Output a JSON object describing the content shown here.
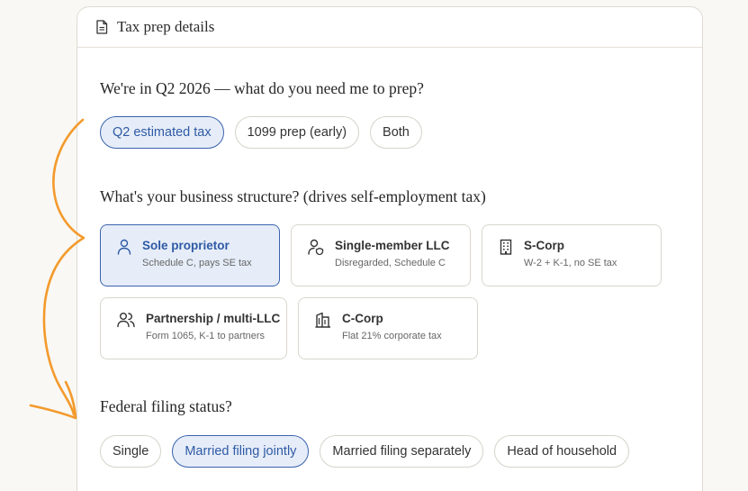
{
  "header": {
    "title": "Tax prep details",
    "icon": "document-icon"
  },
  "q1": {
    "question": "We're in Q2 2026 — what do you need me to prep?",
    "options": [
      "Q2 estimated tax",
      "1099 prep (early)",
      "Both"
    ],
    "selected": 0
  },
  "q2": {
    "question": "What's your business structure? (drives self-employment tax)",
    "options": [
      {
        "title": "Sole proprietor",
        "sub": "Schedule C, pays SE tax",
        "icon": "person-icon"
      },
      {
        "title": "Single-member LLC",
        "sub": "Disregarded, Schedule C",
        "icon": "person-shield-icon"
      },
      {
        "title": "S-Corp",
        "sub": "W-2 + K-1, no SE tax",
        "icon": "building-icon"
      },
      {
        "title": "Partnership / multi-LLC",
        "sub": "Form 1065, K-1 to partners",
        "icon": "people-icon"
      },
      {
        "title": "C-Corp",
        "sub": "Flat 21% corporate tax",
        "icon": "corporate-building-icon"
      }
    ],
    "selected": 0
  },
  "q3": {
    "question": "Federal filing status?",
    "options": [
      "Single",
      "Married filing jointly",
      "Married filing separately",
      "Head of household"
    ],
    "selected": 1
  },
  "colors": {
    "accent": "#3c63ad",
    "selected_bg": "#e6edf8",
    "annotation": "#f39a2c"
  }
}
